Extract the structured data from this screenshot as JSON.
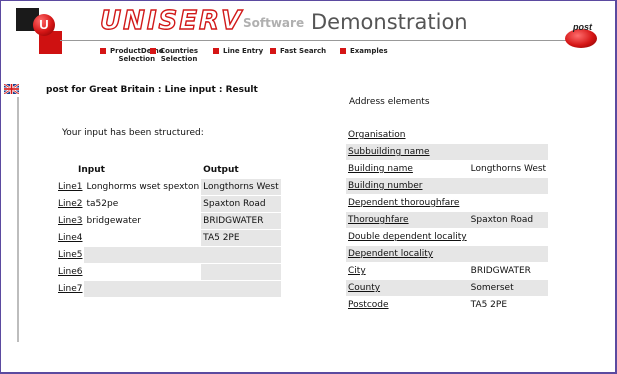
{
  "header": {
    "brand": "UNISERV",
    "software": "Software",
    "demonstration": "Demonstration",
    "post_logo": "post"
  },
  "nav": [
    {
      "label": "ProductDemo\nSelection"
    },
    {
      "label": "Countries\nSelection"
    },
    {
      "label": "Line Entry"
    },
    {
      "label": "Fast Search"
    },
    {
      "label": "Examples"
    }
  ],
  "page": {
    "title": "post for Great Britain : Line input : Result",
    "address_elements_heading": "Address elements",
    "structured_msg": "Your input has been structured:"
  },
  "io_table": {
    "headers": {
      "input": "Input",
      "output": "Output"
    },
    "rows": [
      {
        "line": "Line1",
        "input": "Longhorms wset spexton",
        "output": "Longthorns West"
      },
      {
        "line": "Line2",
        "input": "ta52pe",
        "output": "Spaxton Road"
      },
      {
        "line": "Line3",
        "input": "bridgewater",
        "output": "BRIDGWATER"
      },
      {
        "line": "Line4",
        "input": "",
        "output": "TA5 2PE"
      },
      {
        "line": "Line5",
        "input": "",
        "output": ""
      },
      {
        "line": "Line6",
        "input": "",
        "output": ""
      },
      {
        "line": "Line7",
        "input": "",
        "output": ""
      }
    ]
  },
  "address": [
    {
      "key": "Organisation",
      "value": ""
    },
    {
      "key": "Subbuilding name",
      "value": ""
    },
    {
      "key": "Building name",
      "value": "Longthorns West"
    },
    {
      "key": "Building number",
      "value": ""
    },
    {
      "key": "Dependent thoroughfare",
      "value": ""
    },
    {
      "key": "Thoroughfare",
      "value": "Spaxton Road"
    },
    {
      "key": "Double dependent locality",
      "value": ""
    },
    {
      "key": "Dependent locality",
      "value": ""
    },
    {
      "key": "City",
      "value": "BRIDGWATER"
    },
    {
      "key": "County",
      "value": "Somerset"
    },
    {
      "key": "Postcode",
      "value": "TA5 2PE"
    }
  ],
  "colors": {
    "accent": "#d51515",
    "frame": "#5b4aa0",
    "cell": "#e6e6e6"
  }
}
